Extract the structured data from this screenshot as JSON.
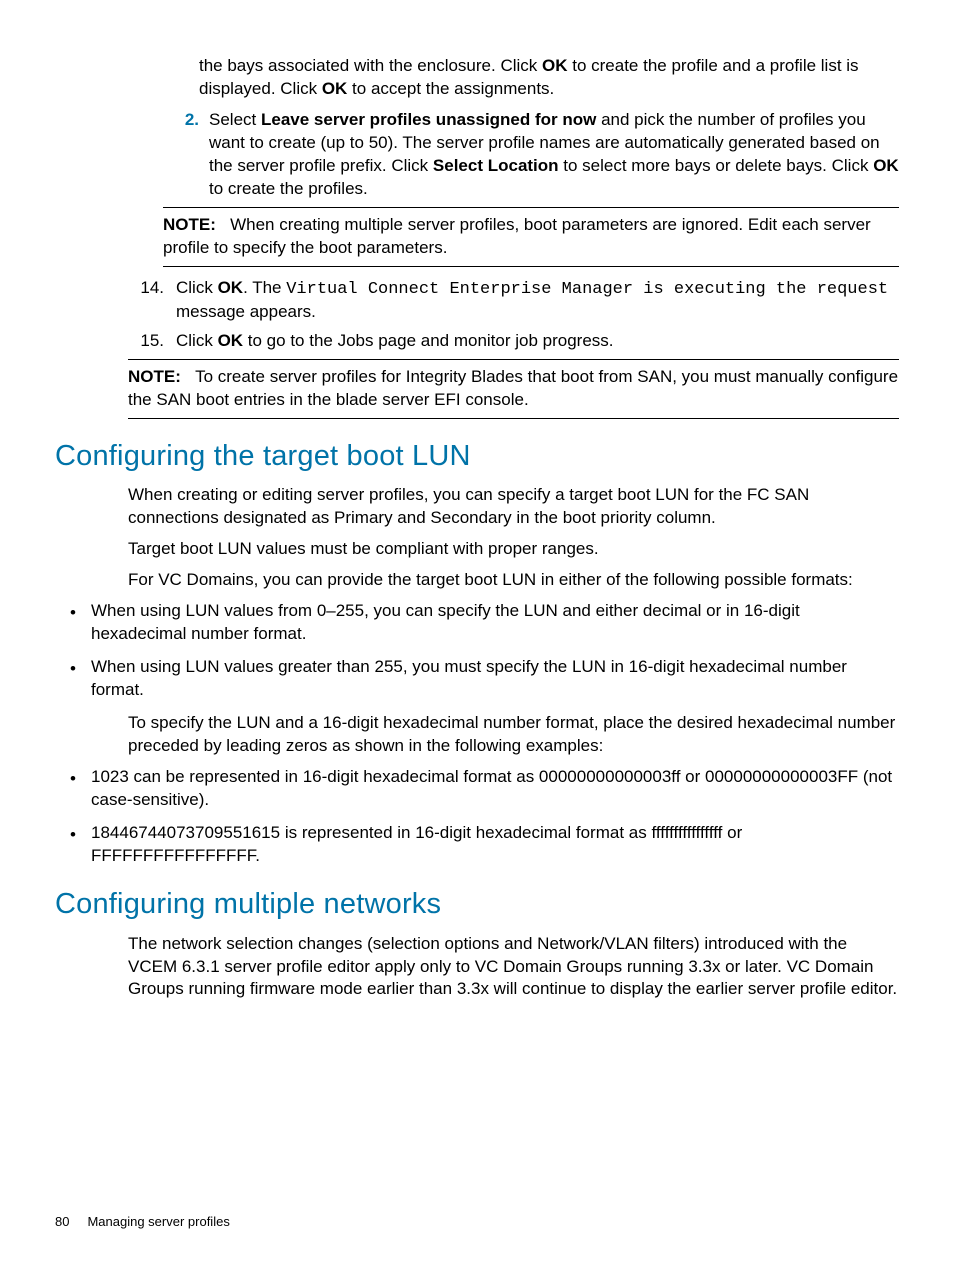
{
  "top": {
    "continued_p1_a": "the bays associated with the enclosure. Click ",
    "continued_p1_ok1": "OK",
    "continued_p1_b": " to create the profile and a profile list is displayed. Click ",
    "continued_p1_ok2": "OK",
    "continued_p1_c": " to accept the assignments.",
    "item2_num": "2.",
    "item2_a": "Select ",
    "item2_bold1": "Leave server profiles unassigned for now",
    "item2_b": " and pick the number of profiles you want to create (up to 50). The server profile names are automatically generated based on the server profile prefix. Click ",
    "item2_bold2": "Select Location",
    "item2_c": " to select more bays or delete bays. Click ",
    "item2_bold3": "OK",
    "item2_d": " to create the profiles."
  },
  "note1": {
    "label": "NOTE:",
    "text": "When creating multiple server profiles, boot parameters are ignored. Edit each server profile to specify the boot parameters."
  },
  "list": {
    "i14_num": "14.",
    "i14_a": "Click ",
    "i14_bold": "OK",
    "i14_b": ". The ",
    "i14_mono": "Virtual Connect Enterprise Manager is executing the request",
    "i14_c": " message appears.",
    "i15_num": "15.",
    "i15_a": "Click ",
    "i15_bold": "OK",
    "i15_b": " to go to the Jobs page and monitor job progress."
  },
  "note2": {
    "label": "NOTE:",
    "text": "To create server profiles for Integrity Blades that boot from SAN, you must manually configure the SAN boot entries in the blade server EFI console."
  },
  "section1": {
    "heading": "Configuring the target boot LUN",
    "p1": "When creating or editing server profiles, you can specify a target boot LUN for the FC SAN connections designated as Primary and Secondary in the boot priority column.",
    "p2": "Target boot LUN values must be compliant with proper ranges.",
    "p3": "For VC Domains, you can provide the target boot LUN in either of the following possible formats:",
    "b1": "When using LUN values from 0–255, you can specify the LUN and either decimal or in 16-digit hexadecimal number format.",
    "b2": "When using LUN values greater than 255, you must specify the LUN in 16-digit hexadecimal number format.",
    "p4": "To specify the LUN and a 16-digit hexadecimal number format, place the desired hexadecimal number preceded by leading zeros as shown in the following examples:",
    "b3": "1023 can be represented in 16-digit hexadecimal format as 00000000000003ff or 00000000000003FF (not case-sensitive).",
    "b4": "18446744073709551615 is represented in 16-digit hexadecimal format as ffffffffffffffff or FFFFFFFFFFFFFFFF."
  },
  "section2": {
    "heading": "Configuring multiple networks",
    "p1": "The network selection changes (selection options and Network/VLAN filters) introduced with the VCEM 6.3.1 server profile editor apply only to VC Domain Groups running 3.3x or later. VC Domain Groups running firmware mode earlier than 3.3x will continue to display the earlier server profile editor."
  },
  "footer": {
    "page_num": "80",
    "title": "Managing server profiles"
  }
}
